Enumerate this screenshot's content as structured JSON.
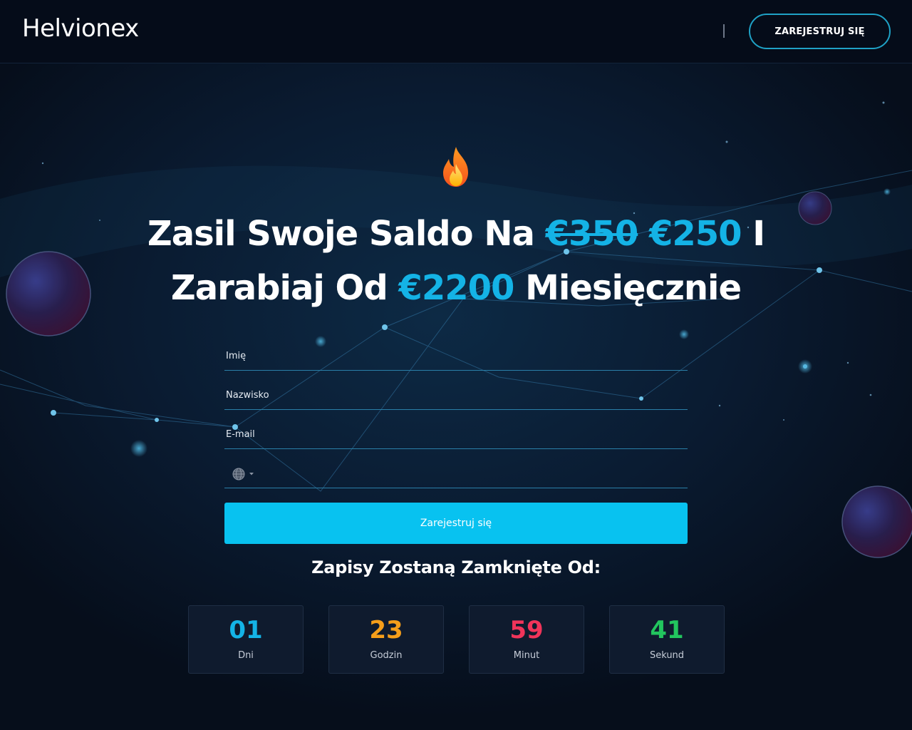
{
  "header": {
    "logo": "Helvionex",
    "register_button": "ZAREJESTRUJ SIĘ"
  },
  "hero": {
    "icon": "fire-icon",
    "headline": {
      "part1": "Zasil Swoje Saldo Na ",
      "old_price": "€350",
      "new_price": "€250",
      "part2": " I",
      "part3": "Zarabiaj Od ",
      "earnings": "€2200",
      "part4": " Miesięcznie"
    }
  },
  "form": {
    "first_name_placeholder": "Imię",
    "last_name_placeholder": "Nazwisko",
    "email_placeholder": "E-mail",
    "phone_prefix_icon": "globe-icon",
    "submit_label": "Zarejestruj się"
  },
  "countdown": {
    "title": "Zapisy Zostaną Zamknięte Od:",
    "items": [
      {
        "value": "01",
        "label": "Dni",
        "color": "#14b3e6"
      },
      {
        "value": "23",
        "label": "Godzin",
        "color": "#f59e1a"
      },
      {
        "value": "59",
        "label": "Minut",
        "color": "#f0345a"
      },
      {
        "value": "41",
        "label": "Sekund",
        "color": "#22c55e"
      }
    ]
  },
  "colors": {
    "accent": "#14b3e6",
    "button": "#08c2f0",
    "background": "#071120"
  }
}
